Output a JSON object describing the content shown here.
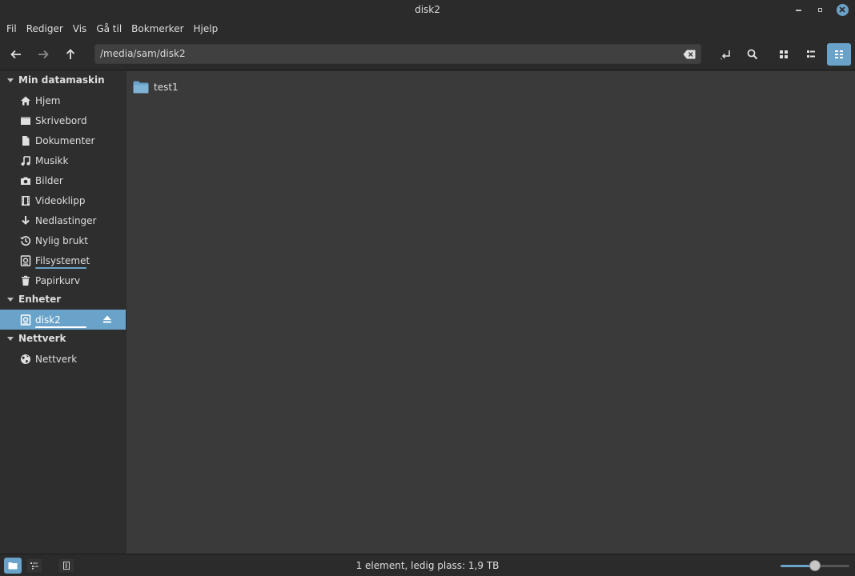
{
  "window": {
    "title": "disk2"
  },
  "menu": [
    "Fil",
    "Rediger",
    "Vis",
    "Gå til",
    "Bokmerker",
    "Hjelp"
  ],
  "toolbar": {
    "location_path": "/media/sam/disk2"
  },
  "sidebar": {
    "sections": [
      {
        "label": "Min datamaskin"
      },
      {
        "label": "Enheter"
      },
      {
        "label": "Nettverk"
      }
    ],
    "computer_items": [
      {
        "label": "Hjem",
        "icon": "home-icon"
      },
      {
        "label": "Skrivebord",
        "icon": "desktop-icon"
      },
      {
        "label": "Dokumenter",
        "icon": "document-icon"
      },
      {
        "label": "Musikk",
        "icon": "music-icon"
      },
      {
        "label": "Bilder",
        "icon": "camera-icon"
      },
      {
        "label": "Videoklipp",
        "icon": "film-icon"
      },
      {
        "label": "Nedlastinger",
        "icon": "download-icon"
      },
      {
        "label": "Nylig brukt",
        "icon": "history-icon"
      },
      {
        "label": "Filsystemet",
        "icon": "drive-icon"
      },
      {
        "label": "Papirkurv",
        "icon": "trash-icon"
      }
    ],
    "device_items": [
      {
        "label": "disk2",
        "icon": "drive-icon",
        "selected": true
      }
    ],
    "network_items": [
      {
        "label": "Nettverk",
        "icon": "globe-icon"
      }
    ]
  },
  "content": {
    "files": [
      {
        "name": "test1",
        "type": "folder"
      }
    ]
  },
  "statusbar": {
    "text": "1 element, ledig plass: 1,9 TB",
    "zoom_level": 0.5
  },
  "colors": {
    "accent": "#6aa3c9",
    "folder": "#6aa3c9"
  }
}
